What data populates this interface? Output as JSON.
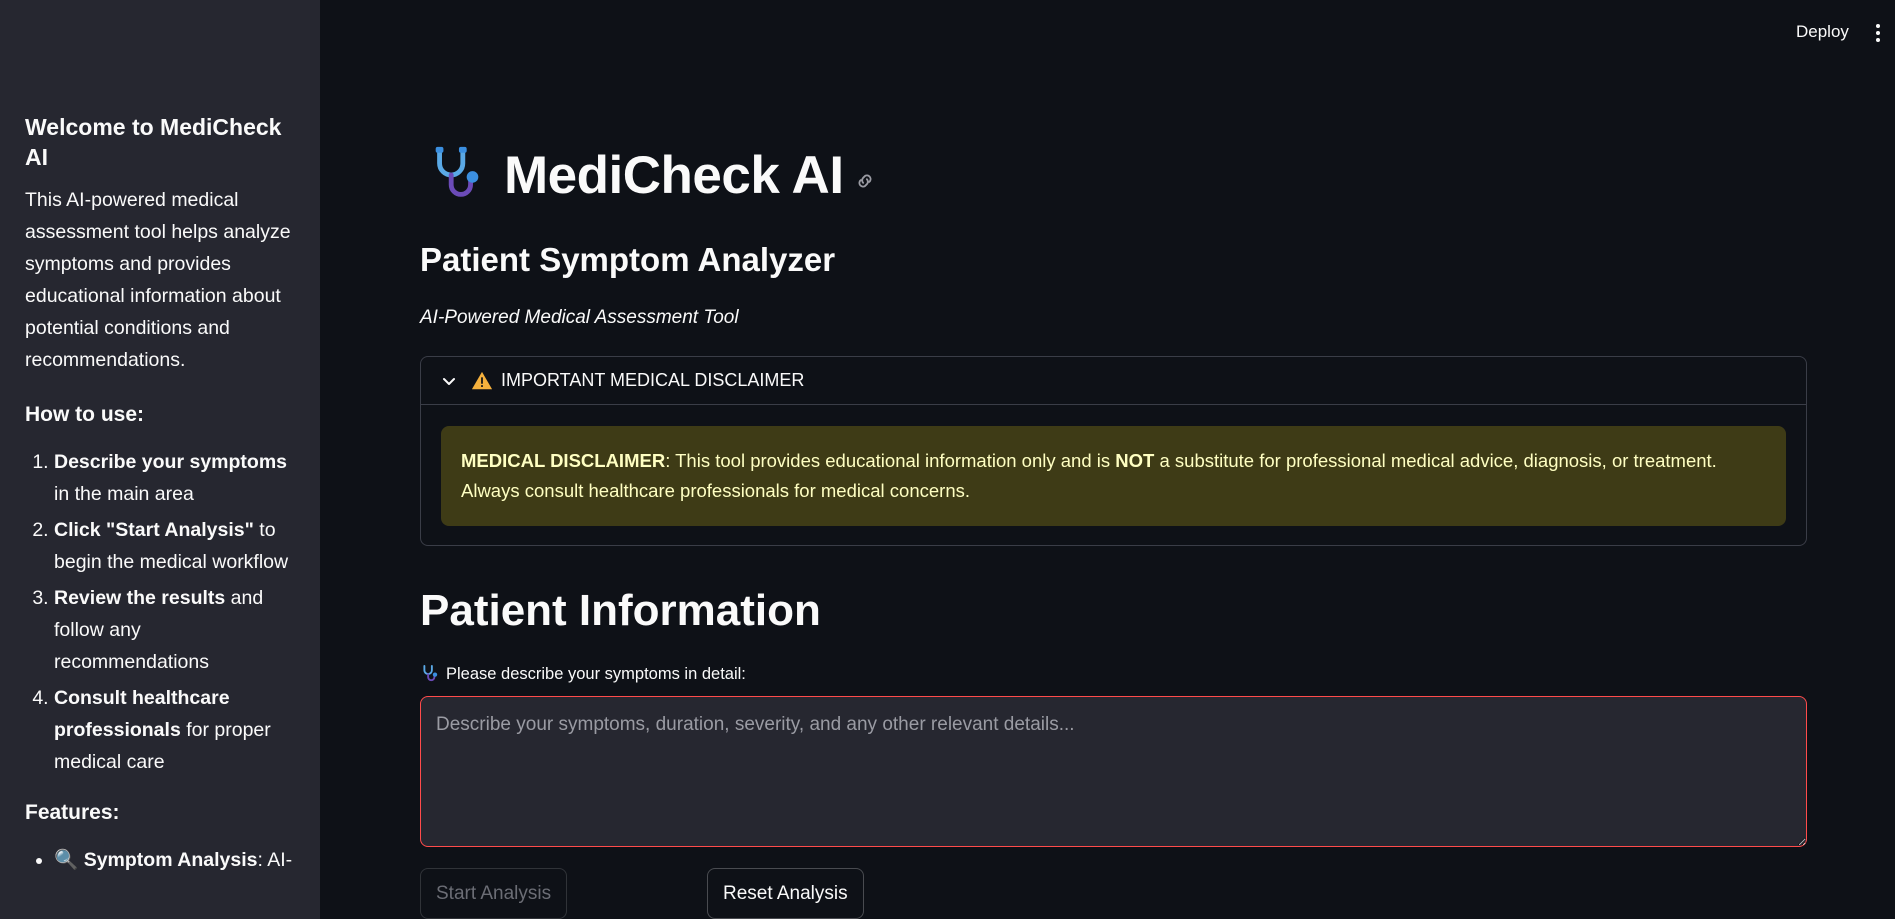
{
  "sidebar": {
    "title": "Welcome to MediCheck AI",
    "intro": "This AI-powered medical assessment tool helps analyze symptoms and provides educational information about potential conditions and recommendations.",
    "how_to_heading": "How to use:",
    "steps": [
      {
        "bold": "Describe your symptoms",
        "rest": " in the main area"
      },
      {
        "bold": "Click \"Start Analysis\"",
        "rest": " to begin the medical workflow"
      },
      {
        "bold": "Review the results",
        "rest": " and follow any recommendations"
      },
      {
        "bold": "Consult healthcare professionals",
        "rest": " for proper medical care"
      }
    ],
    "features_heading": "Features:",
    "features": [
      {
        "icon": "🔍",
        "bold": "Symptom Analysis",
        "rest": ": AI-"
      }
    ]
  },
  "toolbar": {
    "deploy_label": "Deploy"
  },
  "main": {
    "title": "MediCheck AI",
    "subtitle": "Patient Symptom Analyzer",
    "tagline": "AI-Powered Medical Assessment Tool",
    "disclaimer": {
      "header": "IMPORTANT MEDICAL DISCLAIMER",
      "bold_label": "MEDICAL DISCLAIMER",
      "text_1": ": This tool provides educational information only and is ",
      "bold_not": "NOT",
      "text_2": " a substitute for professional medical advice, diagnosis, or treatment. Always consult healthcare professionals for medical concerns."
    },
    "patient_info_heading": "Patient Information",
    "symptoms_label": "Please describe your symptoms in detail:",
    "symptoms_placeholder": "Describe your symptoms, duration, severity, and any other relevant details...",
    "symptoms_value": "",
    "start_button": "Start Analysis",
    "reset_button": "Reset Analysis"
  },
  "colors": {
    "background": "#0e1117",
    "sidebar": "#262730",
    "alert_bg": "#3e3b16",
    "alert_text": "#ffffc2",
    "input_error_border": "#ff4b4b"
  },
  "icons": {
    "title_icon": "stethoscope-icon",
    "header_link": "link-icon",
    "expander_chevron": "chevron-down-icon",
    "warning": "warning-icon",
    "label_icon": "stethoscope-icon",
    "menu": "kebab-menu-icon"
  }
}
